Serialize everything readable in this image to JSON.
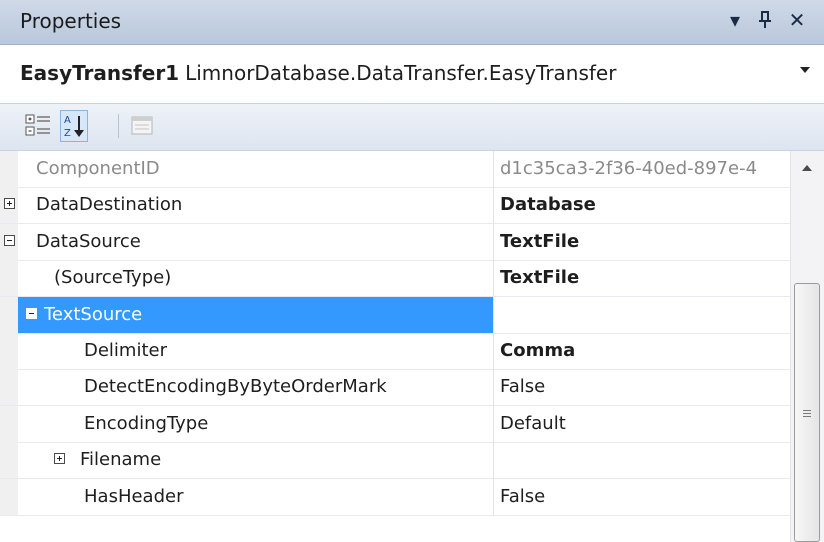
{
  "window": {
    "title": "Properties",
    "dropdown_glyph": "▾",
    "pin_glyph": "ᵻ",
    "close_glyph": "✕"
  },
  "selector": {
    "component_name": "EasyTransfer1",
    "component_type": "LimnorDatabase.DataTransfer.EasyTransfer"
  },
  "toolbar": {
    "categorized_icon": "categorized-icon",
    "alphabetical_icon": "alphabetical-sort-icon",
    "property_pages_icon": "property-pages-icon",
    "alphabetical_selected": true
  },
  "grid": {
    "selected_color": "#3399ff",
    "rows": [
      {
        "name": "ComponentID",
        "value": "d1c35ca3-2f36-40ed-897e-4",
        "level": 0,
        "expander": "",
        "value_bold": false,
        "readonly": true
      },
      {
        "name": "DataDestination",
        "value": "Database",
        "level": 0,
        "expander": "plus",
        "value_bold": true,
        "readonly": false
      },
      {
        "name": "DataSource",
        "value": "TextFile",
        "level": 0,
        "expander": "minus",
        "value_bold": true,
        "readonly": false
      },
      {
        "name": "(SourceType)",
        "value": "TextFile",
        "level": 1,
        "expander": "",
        "value_bold": true,
        "readonly": false
      },
      {
        "name": "TextSource",
        "value": "",
        "level": 1,
        "expander": "minus",
        "value_bold": false,
        "readonly": false,
        "selected": true
      },
      {
        "name": "Delimiter",
        "value": "Comma",
        "level": 2,
        "expander": "",
        "value_bold": true,
        "readonly": false
      },
      {
        "name": "DetectEncodingByByteOrderMark",
        "value": "False",
        "level": 2,
        "expander": "",
        "value_bold": false,
        "readonly": false
      },
      {
        "name": "EncodingType",
        "value": "Default",
        "level": 2,
        "expander": "",
        "value_bold": false,
        "readonly": false
      },
      {
        "name": "Filename",
        "value": "",
        "level": 2,
        "expander": "plus",
        "value_bold": false,
        "readonly": false
      },
      {
        "name": "HasHeader",
        "value": "False",
        "level": 2,
        "expander": "",
        "value_bold": false,
        "readonly": false
      }
    ]
  },
  "scrollbar": {
    "position_fraction": 0.55
  }
}
